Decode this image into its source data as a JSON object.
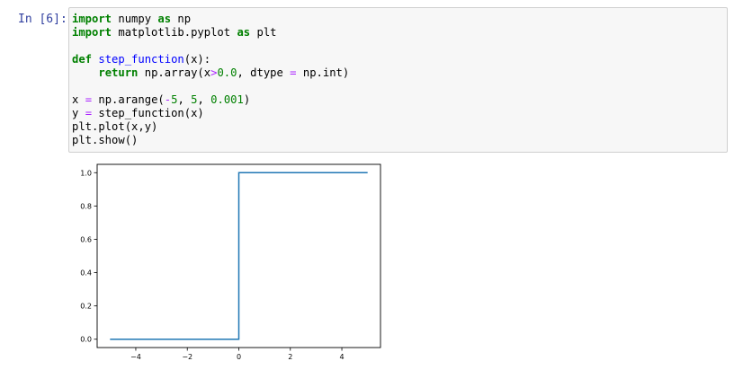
{
  "cell": {
    "prompt": "In [6]:",
    "code_lines": [
      [
        {
          "t": "import",
          "c": "kw"
        },
        {
          "t": " numpy "
        },
        {
          "t": "as",
          "c": "kw"
        },
        {
          "t": " np"
        }
      ],
      [
        {
          "t": "import",
          "c": "kw"
        },
        {
          "t": " matplotlib.pyplot "
        },
        {
          "t": "as",
          "c": "kw"
        },
        {
          "t": " plt"
        }
      ],
      [],
      [
        {
          "t": "def",
          "c": "kw"
        },
        {
          "t": " "
        },
        {
          "t": "step_function",
          "c": "fn"
        },
        {
          "t": "(x):"
        }
      ],
      [
        {
          "t": "    "
        },
        {
          "t": "return",
          "c": "kw"
        },
        {
          "t": " np.array(x"
        },
        {
          "t": ">",
          "c": "op"
        },
        {
          "t": "0.0",
          "c": "num"
        },
        {
          "t": ", dtype "
        },
        {
          "t": "=",
          "c": "op"
        },
        {
          "t": " np.int)"
        }
      ],
      [],
      [
        {
          "t": "x "
        },
        {
          "t": "=",
          "c": "op"
        },
        {
          "t": " np.arange("
        },
        {
          "t": "-",
          "c": "op"
        },
        {
          "t": "5",
          "c": "num"
        },
        {
          "t": ", "
        },
        {
          "t": "5",
          "c": "num"
        },
        {
          "t": ", "
        },
        {
          "t": "0.001",
          "c": "num"
        },
        {
          "t": ")"
        }
      ],
      [
        {
          "t": "y "
        },
        {
          "t": "=",
          "c": "op"
        },
        {
          "t": " step_function(x)"
        }
      ],
      [
        {
          "t": "plt.plot(x,y)"
        }
      ],
      [
        {
          "t": "plt.show()"
        }
      ]
    ]
  },
  "chart_data": {
    "type": "line",
    "x": [
      -5,
      0,
      0,
      5
    ],
    "series": [
      {
        "values": [
          0,
          0,
          1,
          1
        ],
        "color": "#1f77b4"
      }
    ],
    "xlim": [
      -5.5,
      5.5
    ],
    "ylim": [
      -0.05,
      1.05
    ],
    "xticks": [
      -4,
      -2,
      0,
      2,
      4
    ],
    "xtick_labels": [
      "−4",
      "−2",
      "0",
      "2",
      "4"
    ],
    "yticks": [
      0.0,
      0.2,
      0.4,
      0.6,
      0.8,
      1.0
    ],
    "ytick_labels": [
      "0.0",
      "0.2",
      "0.4",
      "0.6",
      "0.8",
      "1.0"
    ],
    "grid": false,
    "title": "",
    "xlabel": "",
    "ylabel": ""
  }
}
